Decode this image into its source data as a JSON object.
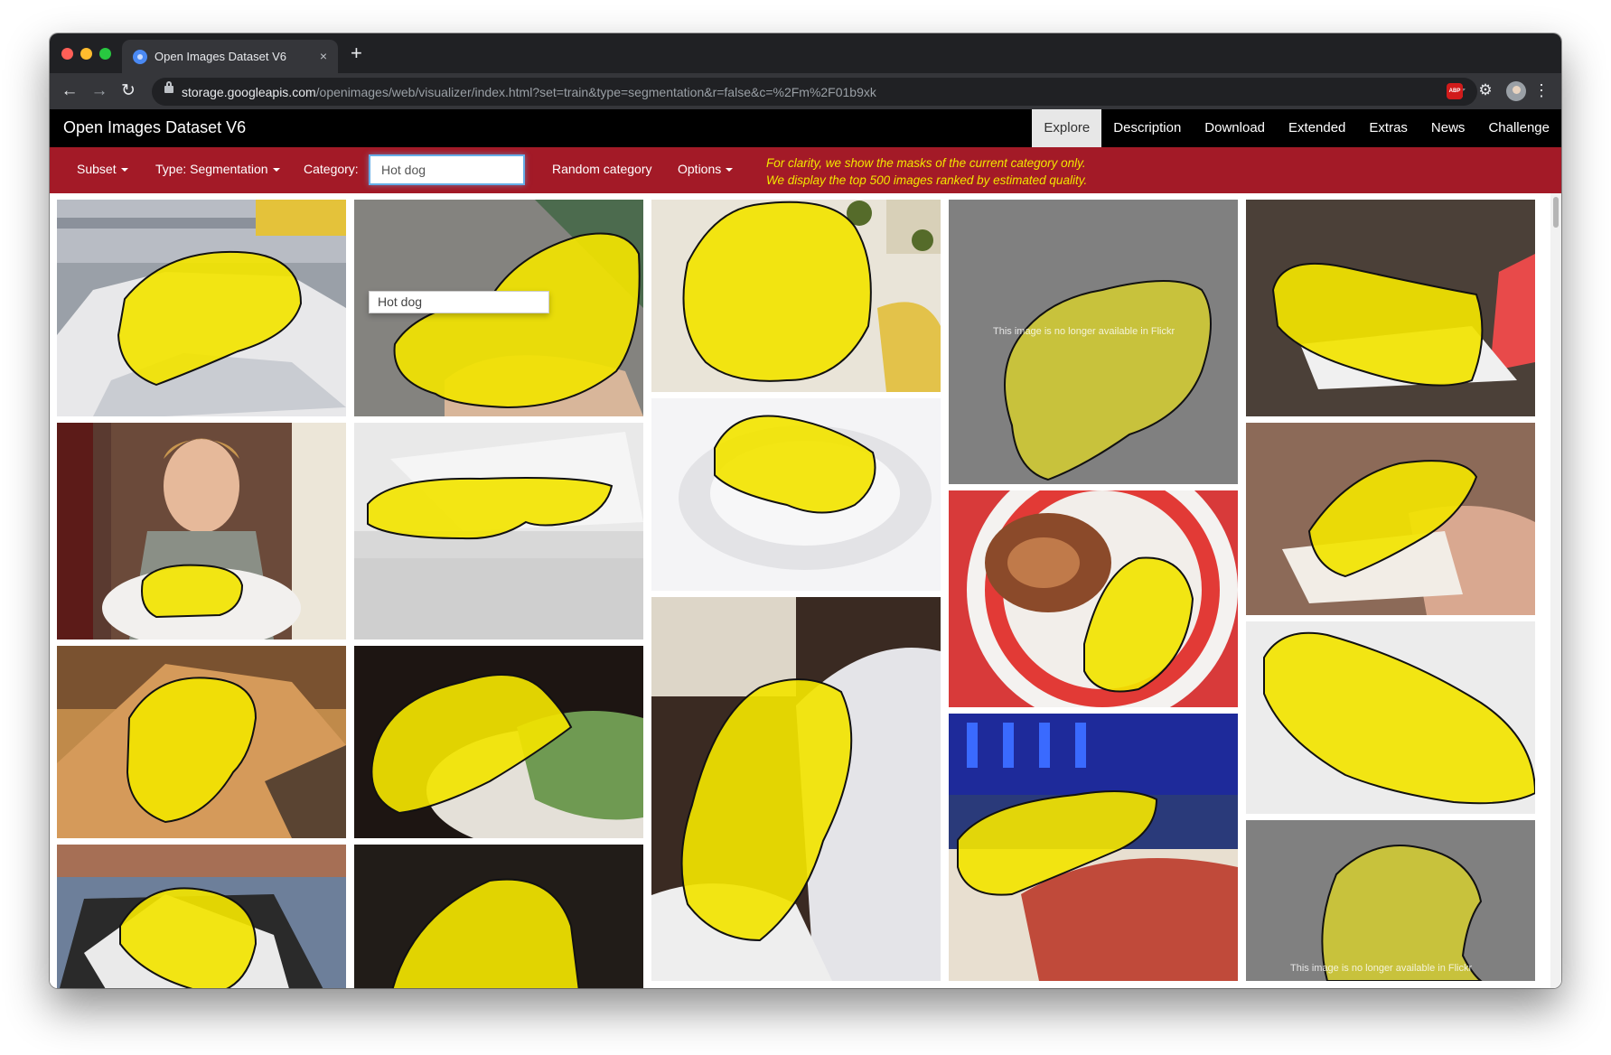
{
  "browser": {
    "tab_title": "Open Images Dataset V6",
    "tab_close": "×",
    "new_tab": "+",
    "url_host": "storage.googleapis.com",
    "url_path": "/openimages/web/visualizer/index.html?set=train&type=segmentation&r=false&c=%2Fm%2F01b9xk",
    "back": "←",
    "forward": "→",
    "reload": "↻",
    "star": "☆",
    "abp": "ABP",
    "puzzle": "⚙",
    "kebab": "⋮"
  },
  "site": {
    "brand": "Open Images Dataset V6",
    "nav": [
      "Explore",
      "Description",
      "Download",
      "Extended",
      "Extras",
      "News",
      "Challenge"
    ],
    "active_nav": "Explore"
  },
  "filters": {
    "subset": "Subset",
    "type": "Type: Segmentation",
    "category_label": "Category:",
    "category_value": "Hot dog",
    "random": "Random category",
    "options": "Options",
    "dropdown_option": "Hot dog",
    "notice_line1": "For clarity, we show the masks of the current category only.",
    "notice_line2": "We display the top 500 images ranked by estimated quality."
  },
  "images": {
    "unavailable_text": "This image is no longer available in Flickr"
  },
  "colors": {
    "tab_bg": "#202124",
    "toolbar_bg": "#35363a",
    "nav_bg": "#000000",
    "filter_bg": "#a31a27",
    "notice": "#f2e600",
    "mask": "#f2e400",
    "unavailable_mask": "#c8c23c"
  }
}
